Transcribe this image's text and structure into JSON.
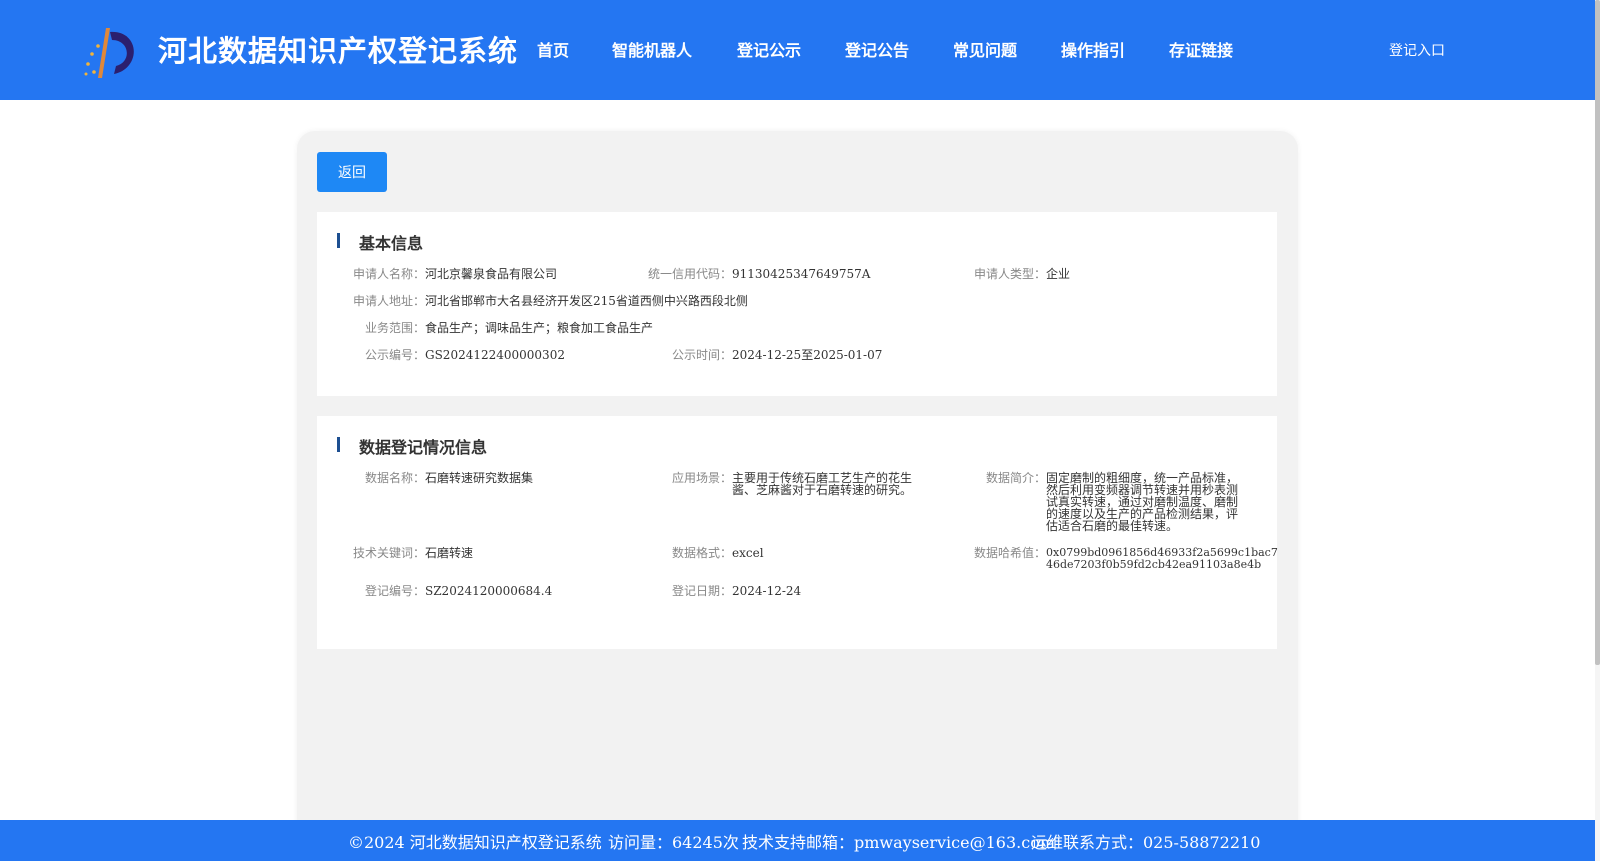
{
  "header": {
    "site_title": "河北数据知识产权登记系统",
    "nav": [
      {
        "label": "首页"
      },
      {
        "label": "智能机器人"
      },
      {
        "label": "登记公示"
      },
      {
        "label": "登记公告"
      },
      {
        "label": "常见问题"
      },
      {
        "label": "操作指引"
      },
      {
        "label": "存证链接"
      }
    ],
    "login_label": "登记入口",
    "accent_color": "#2476f2"
  },
  "panel": {
    "back_label": "返回"
  },
  "basic_info": {
    "title": "基本信息",
    "applicant_name_label": "申请人名称：",
    "applicant_name": "河北京馨泉食品有限公司",
    "credit_code_label": "统一信用代码：",
    "credit_code": "91130425347649757A",
    "applicant_type_label": "申请人类型：",
    "applicant_type": "企业",
    "address_label": "申请人地址：",
    "address": "河北省邯郸市大名县经济开发区215省道西侧中兴路西段北侧",
    "scope_label": "业务范围：",
    "scope": "食品生产；调味品生产；粮食加工食品生产",
    "notice_no_label": "公示编号：",
    "notice_no": "GS2024122400000302",
    "notice_time_label": "公示时间：",
    "notice_time": "2024-12-25至2025-01-07"
  },
  "data_info": {
    "title": "数据登记情况信息",
    "data_name_label": "数据名称：",
    "data_name": "石磨转速研究数据集",
    "scenario_label": "应用场景：",
    "scenario_line1": "主要用于传统石磨工艺生产的花生",
    "scenario_line2": "酱、芝麻酱对于石磨转速的研究。",
    "summary_label": "数据简介：",
    "summary_lines": [
      "固定磨制的粗细度，统一产品标准，",
      "然后利用变频器调节转速并用秒表测",
      "试真实转速，通过对磨制温度、磨制",
      "的速度以及生产的产品检测结果，评",
      "估适合石磨的最佳转速。"
    ],
    "keyword_label": "技术关键词：",
    "keyword": "石磨转速",
    "format_label": "数据格式：",
    "format": "excel",
    "hash_label": "数据哈希值：",
    "hash_line1": "0x0799bd0961856d46933f2a5699c1bac7",
    "hash_line2": "46de7203f0b59fd2cb42ea91103a8e4b",
    "reg_no_label": "登记编号：",
    "reg_no": "SZ2024120000684.4",
    "reg_date_label": "登记日期：",
    "reg_date": "2024-12-24"
  },
  "footer": {
    "copyright": "©2024 河北数据知识产权登记系统",
    "visits": "访问量：64245次",
    "email": "技术支持邮箱：pmwayservice@163.com",
    "phone": "运维联系方式：025-58872210"
  }
}
